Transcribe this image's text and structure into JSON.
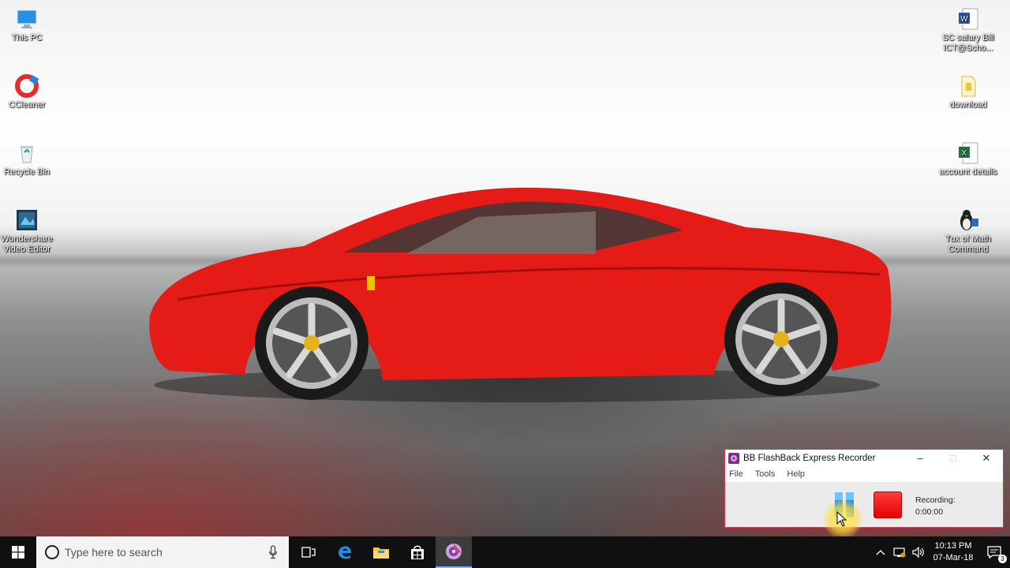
{
  "desktop": {
    "left_icons": [
      {
        "label": "This PC",
        "icon": "computer-icon"
      },
      {
        "label": "CCleaner",
        "icon": "ccleaner-icon"
      },
      {
        "label": "Recycle Bin",
        "icon": "recycle-bin-icon"
      },
      {
        "label": "Wondershare Video Editor",
        "icon": "video-editor-icon"
      }
    ],
    "right_icons": [
      {
        "label": "SC salary Bill ICT@Scho...",
        "icon": "word-document-icon"
      },
      {
        "label": "download",
        "icon": "folder-icon"
      },
      {
        "label": "account details",
        "icon": "excel-document-icon"
      },
      {
        "label": "Tux of Math Command",
        "icon": "tux-math-icon"
      }
    ]
  },
  "recorder": {
    "title": "BB FlashBack Express Recorder",
    "menu": [
      "File",
      "Tools",
      "Help"
    ],
    "status_label": "Recording:",
    "status_time": "0:00:00",
    "accent_color": "#e2355a"
  },
  "taskbar": {
    "search_placeholder": "Type here to search",
    "pinned": [
      "task-view-icon",
      "edge-icon",
      "file-explorer-icon",
      "store-icon",
      "flashback-recorder-icon"
    ],
    "clock_time": "10:13 PM",
    "clock_date": "07-Mar-18",
    "notification_count": "3"
  }
}
